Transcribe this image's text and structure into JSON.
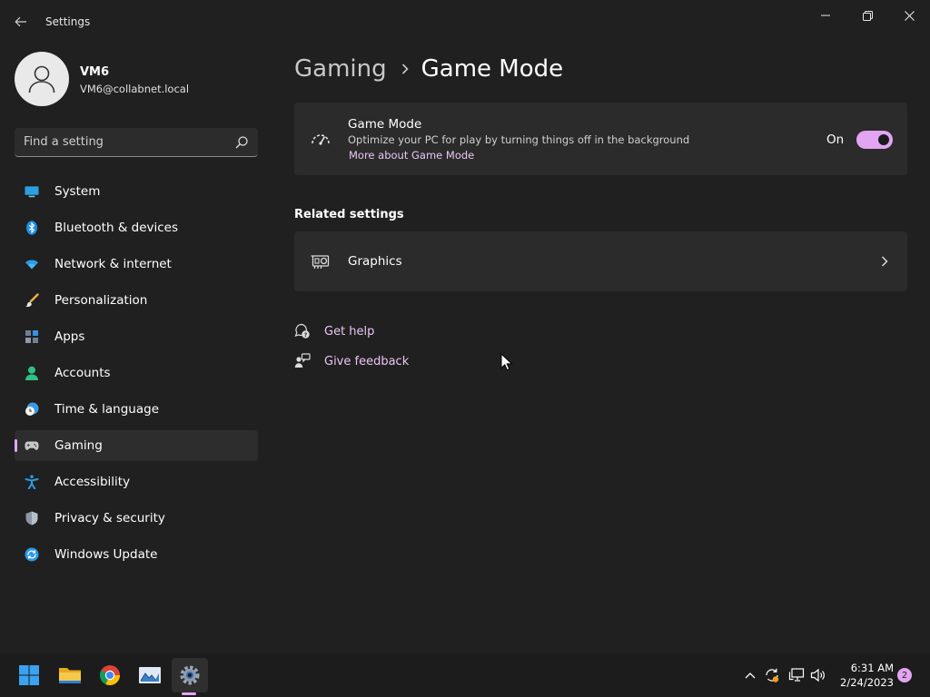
{
  "window": {
    "title": "Settings"
  },
  "profile": {
    "name": "VM6",
    "email": "VM6@collabnet.local"
  },
  "search": {
    "placeholder": "Find a setting"
  },
  "sidebar": {
    "items": [
      {
        "label": "System",
        "icon": "system-icon"
      },
      {
        "label": "Bluetooth & devices",
        "icon": "bluetooth-icon"
      },
      {
        "label": "Network & internet",
        "icon": "wifi-icon"
      },
      {
        "label": "Personalization",
        "icon": "brush-icon"
      },
      {
        "label": "Apps",
        "icon": "apps-icon"
      },
      {
        "label": "Accounts",
        "icon": "person-icon"
      },
      {
        "label": "Time & language",
        "icon": "clock-globe-icon"
      },
      {
        "label": "Gaming",
        "icon": "gamepad-icon",
        "selected": true
      },
      {
        "label": "Accessibility",
        "icon": "accessibility-icon"
      },
      {
        "label": "Privacy & security",
        "icon": "shield-icon"
      },
      {
        "label": "Windows Update",
        "icon": "sync-icon"
      }
    ]
  },
  "breadcrumb": {
    "parent": "Gaming",
    "current": "Game Mode"
  },
  "game_mode": {
    "title": "Game Mode",
    "description": "Optimize your PC for play by turning things off in the background",
    "link": "More about Game Mode",
    "toggle_state": "On",
    "enabled": true
  },
  "related": {
    "title": "Related settings",
    "graphics_label": "Graphics"
  },
  "help": {
    "get_help": "Get help",
    "give_feedback": "Give feedback"
  },
  "taskbar": {
    "apps": [
      "start-icon",
      "file-explorer-icon",
      "chrome-icon",
      "photos-icon",
      "settings-icon"
    ],
    "time": "6:31 AM",
    "date": "2/24/2023",
    "notification_count": "2"
  },
  "colors": {
    "accent": "#e3a5f2",
    "link": "#e9c6f4",
    "background": "#202020",
    "card": "#2b2b2b"
  }
}
